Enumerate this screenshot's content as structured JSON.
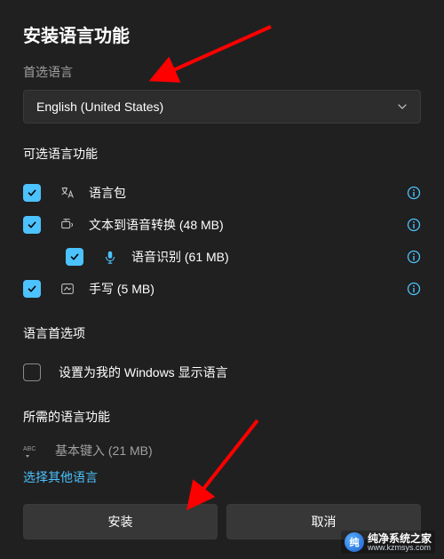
{
  "title": "安装语言功能",
  "preferred": {
    "label": "首选语言",
    "value": "English (United States)"
  },
  "optional": {
    "heading": "可选语言功能",
    "items": [
      {
        "label": "语言包",
        "checked": true,
        "indent": false,
        "icon": "language-pack"
      },
      {
        "label": "文本到语音转换 (48 MB)",
        "checked": true,
        "indent": false,
        "icon": "tts"
      },
      {
        "label": "语音识别 (61 MB)",
        "checked": true,
        "indent": true,
        "icon": "speech"
      },
      {
        "label": "手写 (5 MB)",
        "checked": true,
        "indent": false,
        "icon": "handwriting"
      }
    ]
  },
  "prefs": {
    "heading": "语言首选项",
    "set_display_label": "设置为我的 Windows 显示语言",
    "set_display_checked": false
  },
  "required": {
    "heading": "所需的语言功能",
    "basic_typing_label": "基本键入 (21 MB)"
  },
  "link_other": "选择其他语言",
  "buttons": {
    "install": "安装",
    "cancel": "取消"
  },
  "watermark": {
    "cn": "纯净系统之家",
    "url": "www.kzmsys.com"
  },
  "colors": {
    "accent": "#4cc2ff",
    "arrow": "#ff0000"
  }
}
